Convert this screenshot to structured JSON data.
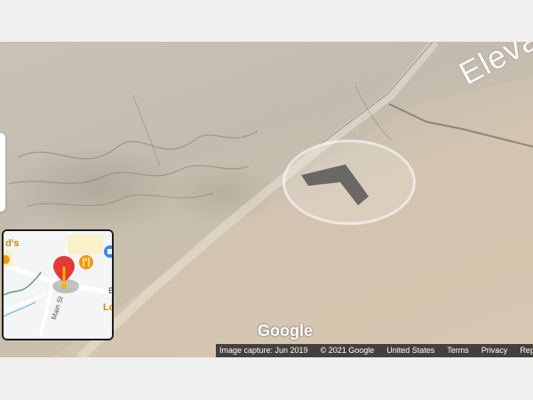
{
  "street_view": {
    "street_label": "Eleva",
    "google_logo": "Google"
  },
  "minimap": {
    "place_top_left": "d's",
    "label_b": "B",
    "label_lo": "Lo",
    "street_name": "Main St"
  },
  "footer": {
    "image_capture": "Image capture: Jun 2019",
    "copyright": "© 2021 Google",
    "country": "United States",
    "terms": "Terms",
    "privacy": "Privacy",
    "report": "Report"
  },
  "colors": {
    "pin_red": "#e53935",
    "pin_yellow": "#f4b400",
    "food_orange": "#f29900",
    "shop_blue": "#4285f4",
    "footer_bg": "#232323"
  },
  "icons": {
    "nav_arrow": "chevron-up-icon",
    "pin": "location-pin-icon",
    "food": "restaurant-icon",
    "shop": "shopping-bag-icon"
  }
}
